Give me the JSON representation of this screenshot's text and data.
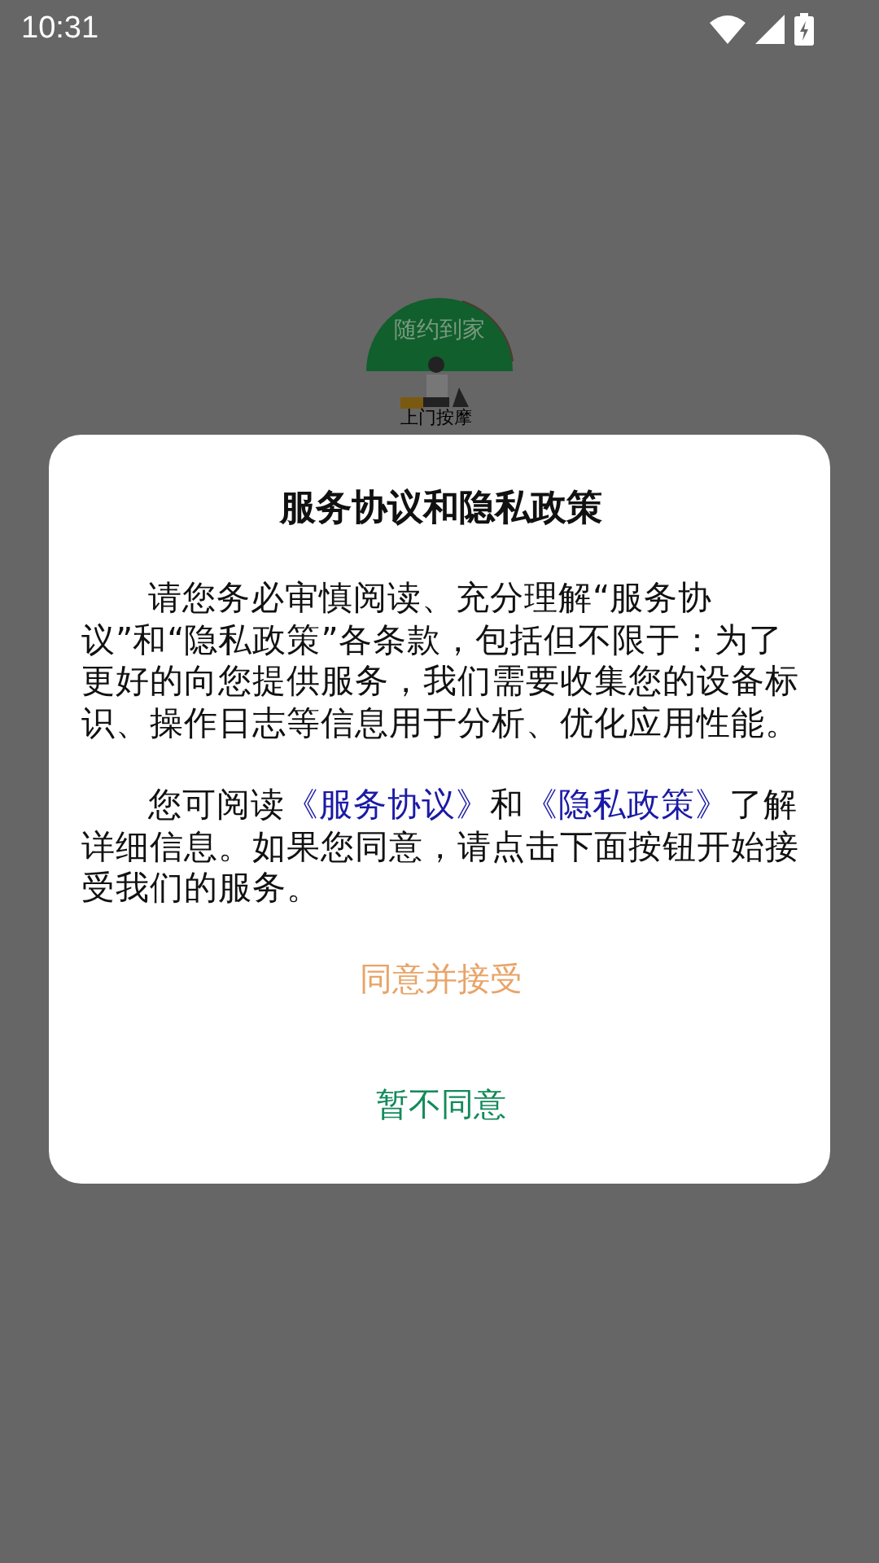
{
  "status_bar": {
    "time": "10:31"
  },
  "logo": {
    "title": "随约到家",
    "caption": "上门按摩"
  },
  "dialog": {
    "title": "服务协议和隐私政策",
    "paragraphs": [
      {
        "parts": [
          {
            "kind": "text",
            "text": "请您务必审慎阅读、充分理解“服务协议”和“隐私政策”各条款，包括但不限于：为了更好的向您提供服务，我们需要收集您的设备标识、操作日志等信息用于分析、优化应用性能。"
          }
        ]
      },
      {
        "parts": [
          {
            "kind": "text",
            "text": "您可阅读"
          },
          {
            "kind": "link",
            "text": "《服务协议》"
          },
          {
            "kind": "text",
            "text": "和"
          },
          {
            "kind": "link",
            "text": "《隐私政策》"
          },
          {
            "kind": "text",
            "text": "了解详细信息。如果您同意，请点击下面按钮开始接受我们的服务。"
          }
        ]
      }
    ],
    "buttons": [
      {
        "kind": "accept",
        "label": "同意并接受"
      },
      {
        "kind": "decline",
        "label": "暂不同意"
      }
    ]
  }
}
